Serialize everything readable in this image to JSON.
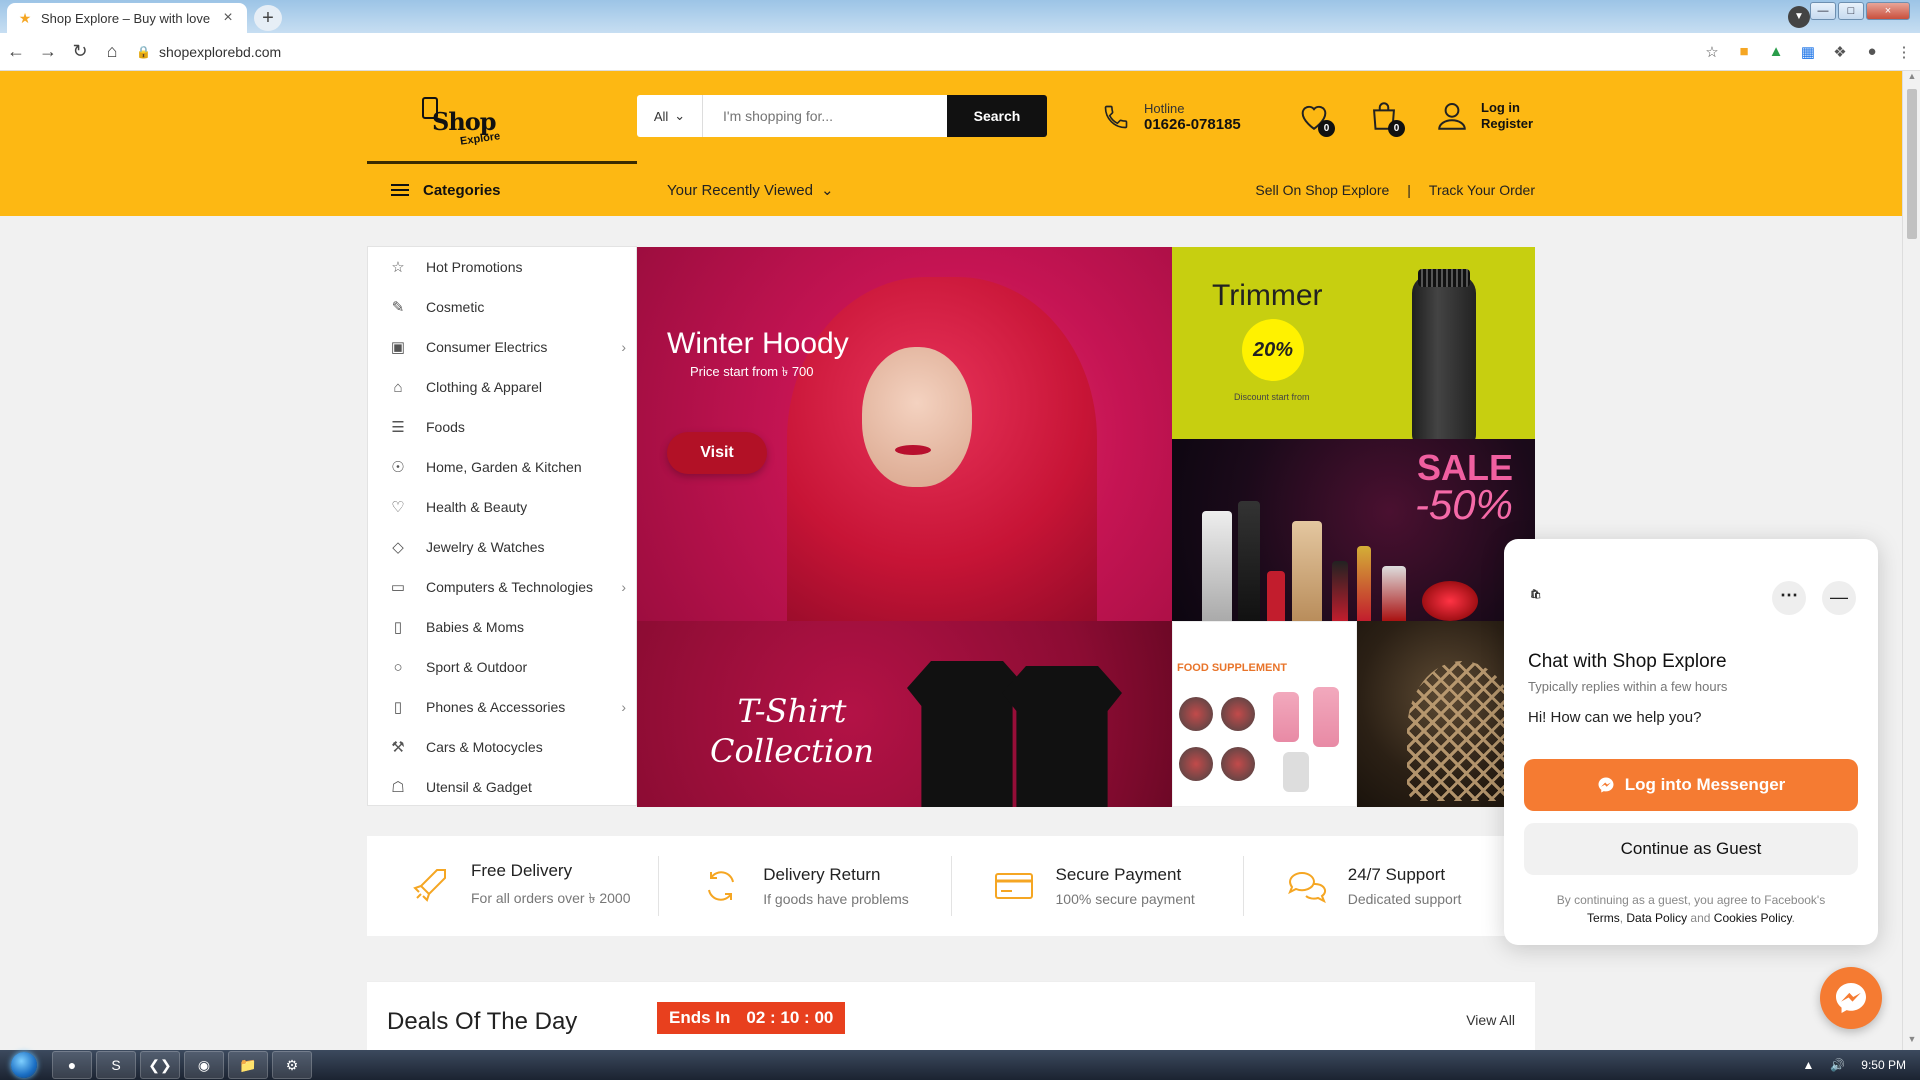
{
  "browser": {
    "tab_title": "Shop Explore – Buy with love",
    "url": "shopexplorebd.com",
    "icons": [
      "back-icon",
      "forward-icon",
      "reload-icon",
      "home-icon",
      "lock-icon",
      "star-icon",
      "extension-icon",
      "profile-icon",
      "menu-icon"
    ]
  },
  "header": {
    "logo_shop": "Shop",
    "logo_explore": "Explore",
    "search": {
      "category": "All",
      "placeholder": "I'm shopping for...",
      "button": "Search"
    },
    "hotline_label": "Hotline",
    "hotline_number": "01626-078185",
    "wishlist_count": "0",
    "cart_count": "0",
    "login": "Log in",
    "register": "Register",
    "accent_color": "#fdb813"
  },
  "nav": {
    "categories": "Categories",
    "recently_viewed": "Your Recently Viewed",
    "sell": "Sell On Shop Explore",
    "track": "Track Your Order"
  },
  "sidebar": {
    "items": [
      {
        "label": "Hot Promotions",
        "icon": "star-icon",
        "arrow": false
      },
      {
        "label": "Cosmetic",
        "icon": "brush-icon",
        "arrow": false
      },
      {
        "label": "Consumer Electrics",
        "icon": "washer-icon",
        "arrow": true
      },
      {
        "label": "Clothing & Apparel",
        "icon": "shirt-icon",
        "arrow": false
      },
      {
        "label": "Foods",
        "icon": "burger-icon",
        "arrow": false
      },
      {
        "label": "Home, Garden & Kitchen",
        "icon": "lamp-icon",
        "arrow": false
      },
      {
        "label": "Health & Beauty",
        "icon": "heart-pulse-icon",
        "arrow": false
      },
      {
        "label": "Jewelry & Watches",
        "icon": "diamond-icon",
        "arrow": false
      },
      {
        "label": "Computers & Technologies",
        "icon": "monitor-icon",
        "arrow": true
      },
      {
        "label": "Babies & Moms",
        "icon": "baby-bottle-icon",
        "arrow": false
      },
      {
        "label": "Sport & Outdoor",
        "icon": "ball-icon",
        "arrow": false
      },
      {
        "label": "Phones & Accessories",
        "icon": "phone-icon",
        "arrow": true
      },
      {
        "label": "Cars & Motocycles",
        "icon": "car-icon",
        "arrow": false
      },
      {
        "label": "Utensil & Gadget",
        "icon": "gamepad-icon",
        "arrow": false
      }
    ]
  },
  "banners": {
    "main_title": "Winter Hoody",
    "main_sub": "Price start from ৳ 700",
    "main_button": "Visit",
    "trimmer_title": "Trimmer",
    "trimmer_discount": "20%",
    "trimmer_sub": "Discount start from",
    "sale_title": "SALE",
    "sale_percent": "-50%",
    "tshirt_title": "T-Shirt Collection",
    "food_title": "FOOD SUPPLEMENT"
  },
  "features": [
    {
      "title": "Free Delivery",
      "desc": "For all orders over ৳ 2000",
      "icon": "rocket-icon"
    },
    {
      "title": "Delivery Return",
      "desc": "If goods have problems",
      "icon": "refresh-icon"
    },
    {
      "title": "Secure Payment",
      "desc": "100% secure payment",
      "icon": "credit-card-icon"
    },
    {
      "title": "24/7 Support",
      "desc": "Dedicated support",
      "icon": "chat-bubbles-icon"
    }
  ],
  "deals": {
    "title": "Deals Of The Day",
    "ends_in": "Ends In",
    "timer": "02 : 10 : 00",
    "view_all": "View All"
  },
  "chat": {
    "title": "Chat with Shop Explore",
    "subtitle": "Typically replies within a few hours",
    "greeting": "Hi! How can we help you?",
    "login_button": "Log into Messenger",
    "guest_button": "Continue as Guest",
    "legal_prefix": "By continuing as a guest, you agree to Facebook's",
    "terms": "Terms",
    "data_policy": "Data Policy",
    "and": "and",
    "cookies": "Cookies Policy",
    "brand_color": "#f57b32"
  },
  "taskbar": {
    "clock": "9:50 PM"
  }
}
